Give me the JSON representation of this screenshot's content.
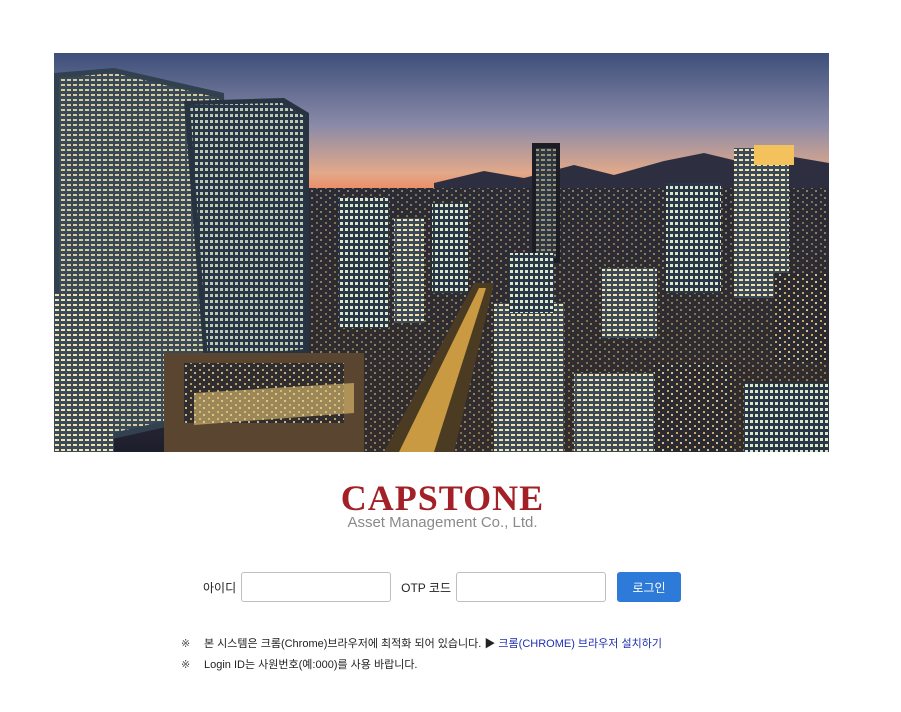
{
  "hero": {
    "image": "seoul-city-skyline-at-dusk"
  },
  "logo": {
    "main": "CAPSTONE",
    "sub": "Asset Management Co., Ltd.",
    "color": "#a32026"
  },
  "login": {
    "id_label": "아이디",
    "id_value": "",
    "otp_label": "OTP 코드",
    "otp_value": "",
    "button_label": "로그인",
    "button_color": "#2d7ad9"
  },
  "notices": [
    {
      "mark": "※",
      "text": "본 시스템은 크롬(Chrome)브라우저에 최적화 되어 있습니다. ▶ ",
      "link": "크롬(CHROME) 브라우저 설치하기"
    },
    {
      "mark": "※",
      "text": "Login ID는 사원번호(예:000)를 사용 바랍니다."
    }
  ]
}
